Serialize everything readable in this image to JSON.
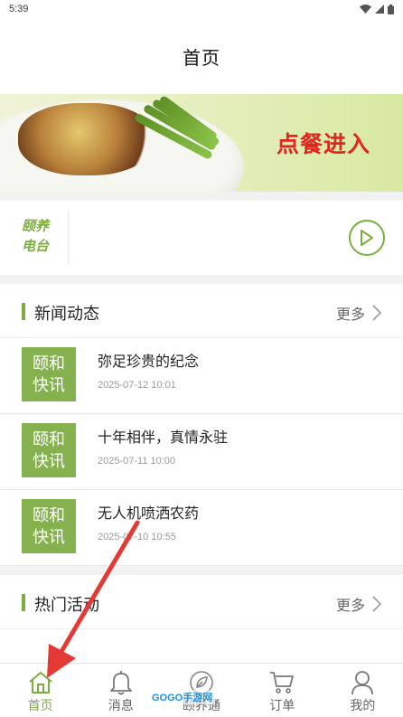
{
  "status_bar": {
    "time": "5:39"
  },
  "header": {
    "title": "首页"
  },
  "banner": {
    "cta": "点餐进入"
  },
  "radio": {
    "label_line1": "颐养",
    "label_line2": "电台",
    "play_icon": "play-circle-icon"
  },
  "news": {
    "title": "新闻动态",
    "more": "更多",
    "items": [
      {
        "tag_line1": "颐和",
        "tag_line2": "快讯",
        "title": "弥足珍贵的纪念",
        "date": "2025-07-12 10:01"
      },
      {
        "tag_line1": "颐和",
        "tag_line2": "快讯",
        "title": "十年相伴，真情永驻",
        "date": "2025-07-11 10:00"
      },
      {
        "tag_line1": "颐和",
        "tag_line2": "快讯",
        "title": "无人机喷洒农药",
        "date": "2025-07-10 10:55"
      }
    ]
  },
  "events": {
    "title": "热门活动",
    "more": "更多"
  },
  "tabbar": {
    "items": [
      {
        "label": "首页",
        "icon": "home-icon",
        "active": true
      },
      {
        "label": "消息",
        "icon": "bell-icon",
        "active": false
      },
      {
        "label": "颐养通",
        "icon": "leaf-icon",
        "active": false
      },
      {
        "label": "订单",
        "icon": "cart-icon",
        "active": false
      },
      {
        "label": "我的",
        "icon": "user-icon",
        "active": false
      }
    ]
  },
  "watermark": {
    "text": "GOGO手游网"
  },
  "colors": {
    "accent": "#7cad3f",
    "tag_bg": "#85b24e",
    "cta_red": "#e0261d",
    "arrow_red": "#e53935"
  }
}
